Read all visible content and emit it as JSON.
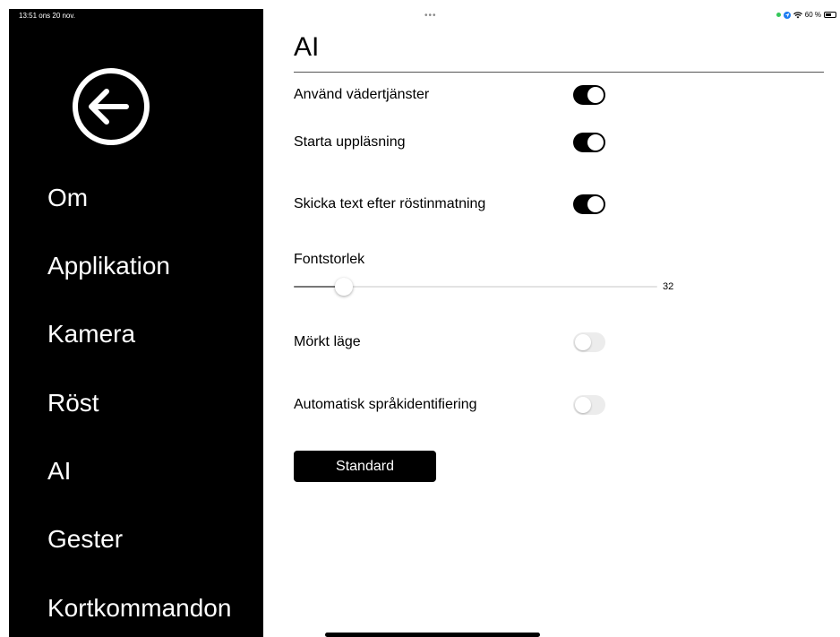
{
  "status_bar": {
    "time_date": "13:51  ons 20 nov.",
    "dots": "•••",
    "battery_text": "60 %",
    "battery_level": 0.6
  },
  "sidebar": {
    "back_icon": "arrow-left-circle-icon",
    "items": [
      {
        "label": "Om"
      },
      {
        "label": "Applikation"
      },
      {
        "label": "Kamera"
      },
      {
        "label": "Röst"
      },
      {
        "label": "AI"
      },
      {
        "label": "Gester"
      },
      {
        "label": "Kortkommandon"
      }
    ]
  },
  "main": {
    "title": "AI",
    "settings": {
      "weather": {
        "label": "Använd vädertjänster",
        "on": true
      },
      "readout": {
        "label": "Starta uppläsning",
        "on": true
      },
      "send_text": {
        "label": "Skicka text efter röstinmatning",
        "on": true
      },
      "dark_mode": {
        "label": "Mörkt läge",
        "on": false
      },
      "auto_lang": {
        "label": "Automatisk språkidentifiering",
        "on": false
      }
    },
    "font_size": {
      "label": "Fontstorlek",
      "value": "32",
      "fraction": 0.12
    },
    "standard_button": "Standard"
  },
  "colors": {
    "sidebar_bg": "#000000",
    "toggle_on": "#000000",
    "toggle_off": "#ececec",
    "status_green": "#34c759",
    "location_blue": "#1e7cf2"
  }
}
